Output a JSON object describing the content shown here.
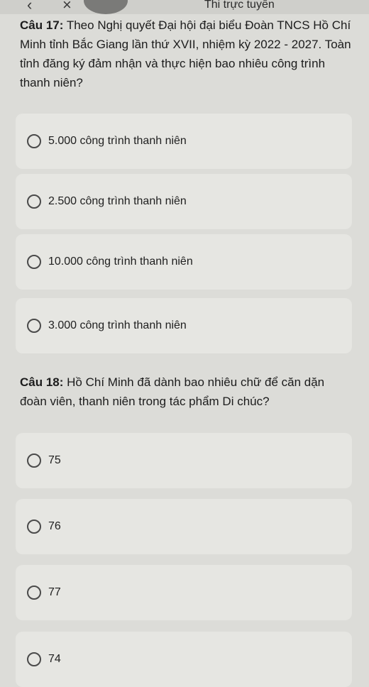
{
  "header": {
    "title": "Thi trực tuyến",
    "back_icon": "chevron-left-icon",
    "close_icon": "close-icon"
  },
  "questions": [
    {
      "number_label": "Câu 17:",
      "text": "Theo Nghị quyết Đại hội đại biểu Đoàn TNCS Hồ Chí Minh tỉnh Bắc Giang lần thứ XVII, nhiệm kỳ 2022 - 2027. Toàn tỉnh đăng ký đảm nhận và thực hiện bao nhiêu công trình thanh niên?",
      "options": [
        {
          "label": "5.000 công trình thanh niên"
        },
        {
          "label": "2.500 công trình thanh niên"
        },
        {
          "label": "10.000 công trình thanh niên"
        },
        {
          "label": "3.000 công trình thanh niên"
        }
      ]
    },
    {
      "number_label": "Câu 18:",
      "text": "Hồ Chí Minh đã dành bao nhiêu chữ để căn dặn đoàn viên, thanh niên trong tác phẩm Di chúc?",
      "options": [
        {
          "label": "75"
        },
        {
          "label": "76"
        },
        {
          "label": "77"
        },
        {
          "label": "74"
        }
      ]
    }
  ]
}
